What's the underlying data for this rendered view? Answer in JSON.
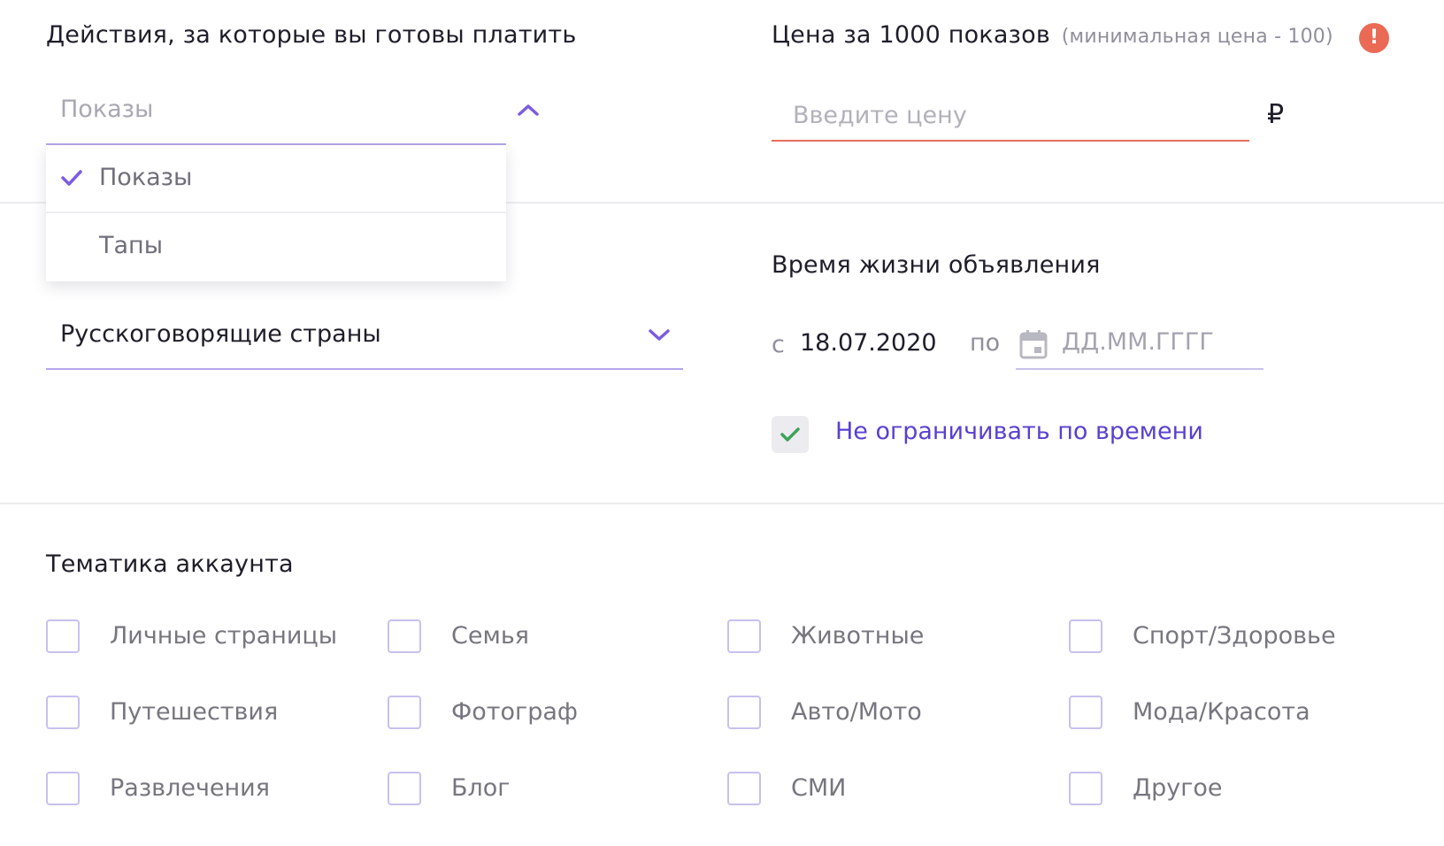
{
  "actions": {
    "label": "Действия, за которые вы готовы платить",
    "selected": "Показы",
    "options": [
      "Показы",
      "Тапы"
    ]
  },
  "price": {
    "label": "Цена за 1000 показов",
    "hint": "(минимальная цена - 100)",
    "placeholder": "Введите цену",
    "currency": "₽",
    "alert": "!"
  },
  "region": {
    "selected": "Русскоговорящие страны"
  },
  "lifetime": {
    "label": "Время жизни объявления",
    "from_prefix": "с",
    "from_value": "18.07.2020",
    "to_prefix": "по",
    "to_placeholder": "ДД.ММ.ГГГГ",
    "unlimited_label": "Не ограничивать по времени",
    "unlimited_checked": true
  },
  "topics": {
    "label": "Тематика аккаунта",
    "items": [
      "Личные страницы",
      "Семья",
      "Животные",
      "Спорт/Здоровье",
      "Путешествия",
      "Фотограф",
      "Авто/Мото",
      "Мода/Красота",
      "Развлечения",
      "Блог",
      "СМИ",
      "Другое"
    ]
  },
  "colors": {
    "accent": "#7b5ce0",
    "link": "#5b3fd1",
    "error": "#e86e5c",
    "success_check": "#3ea25a"
  }
}
